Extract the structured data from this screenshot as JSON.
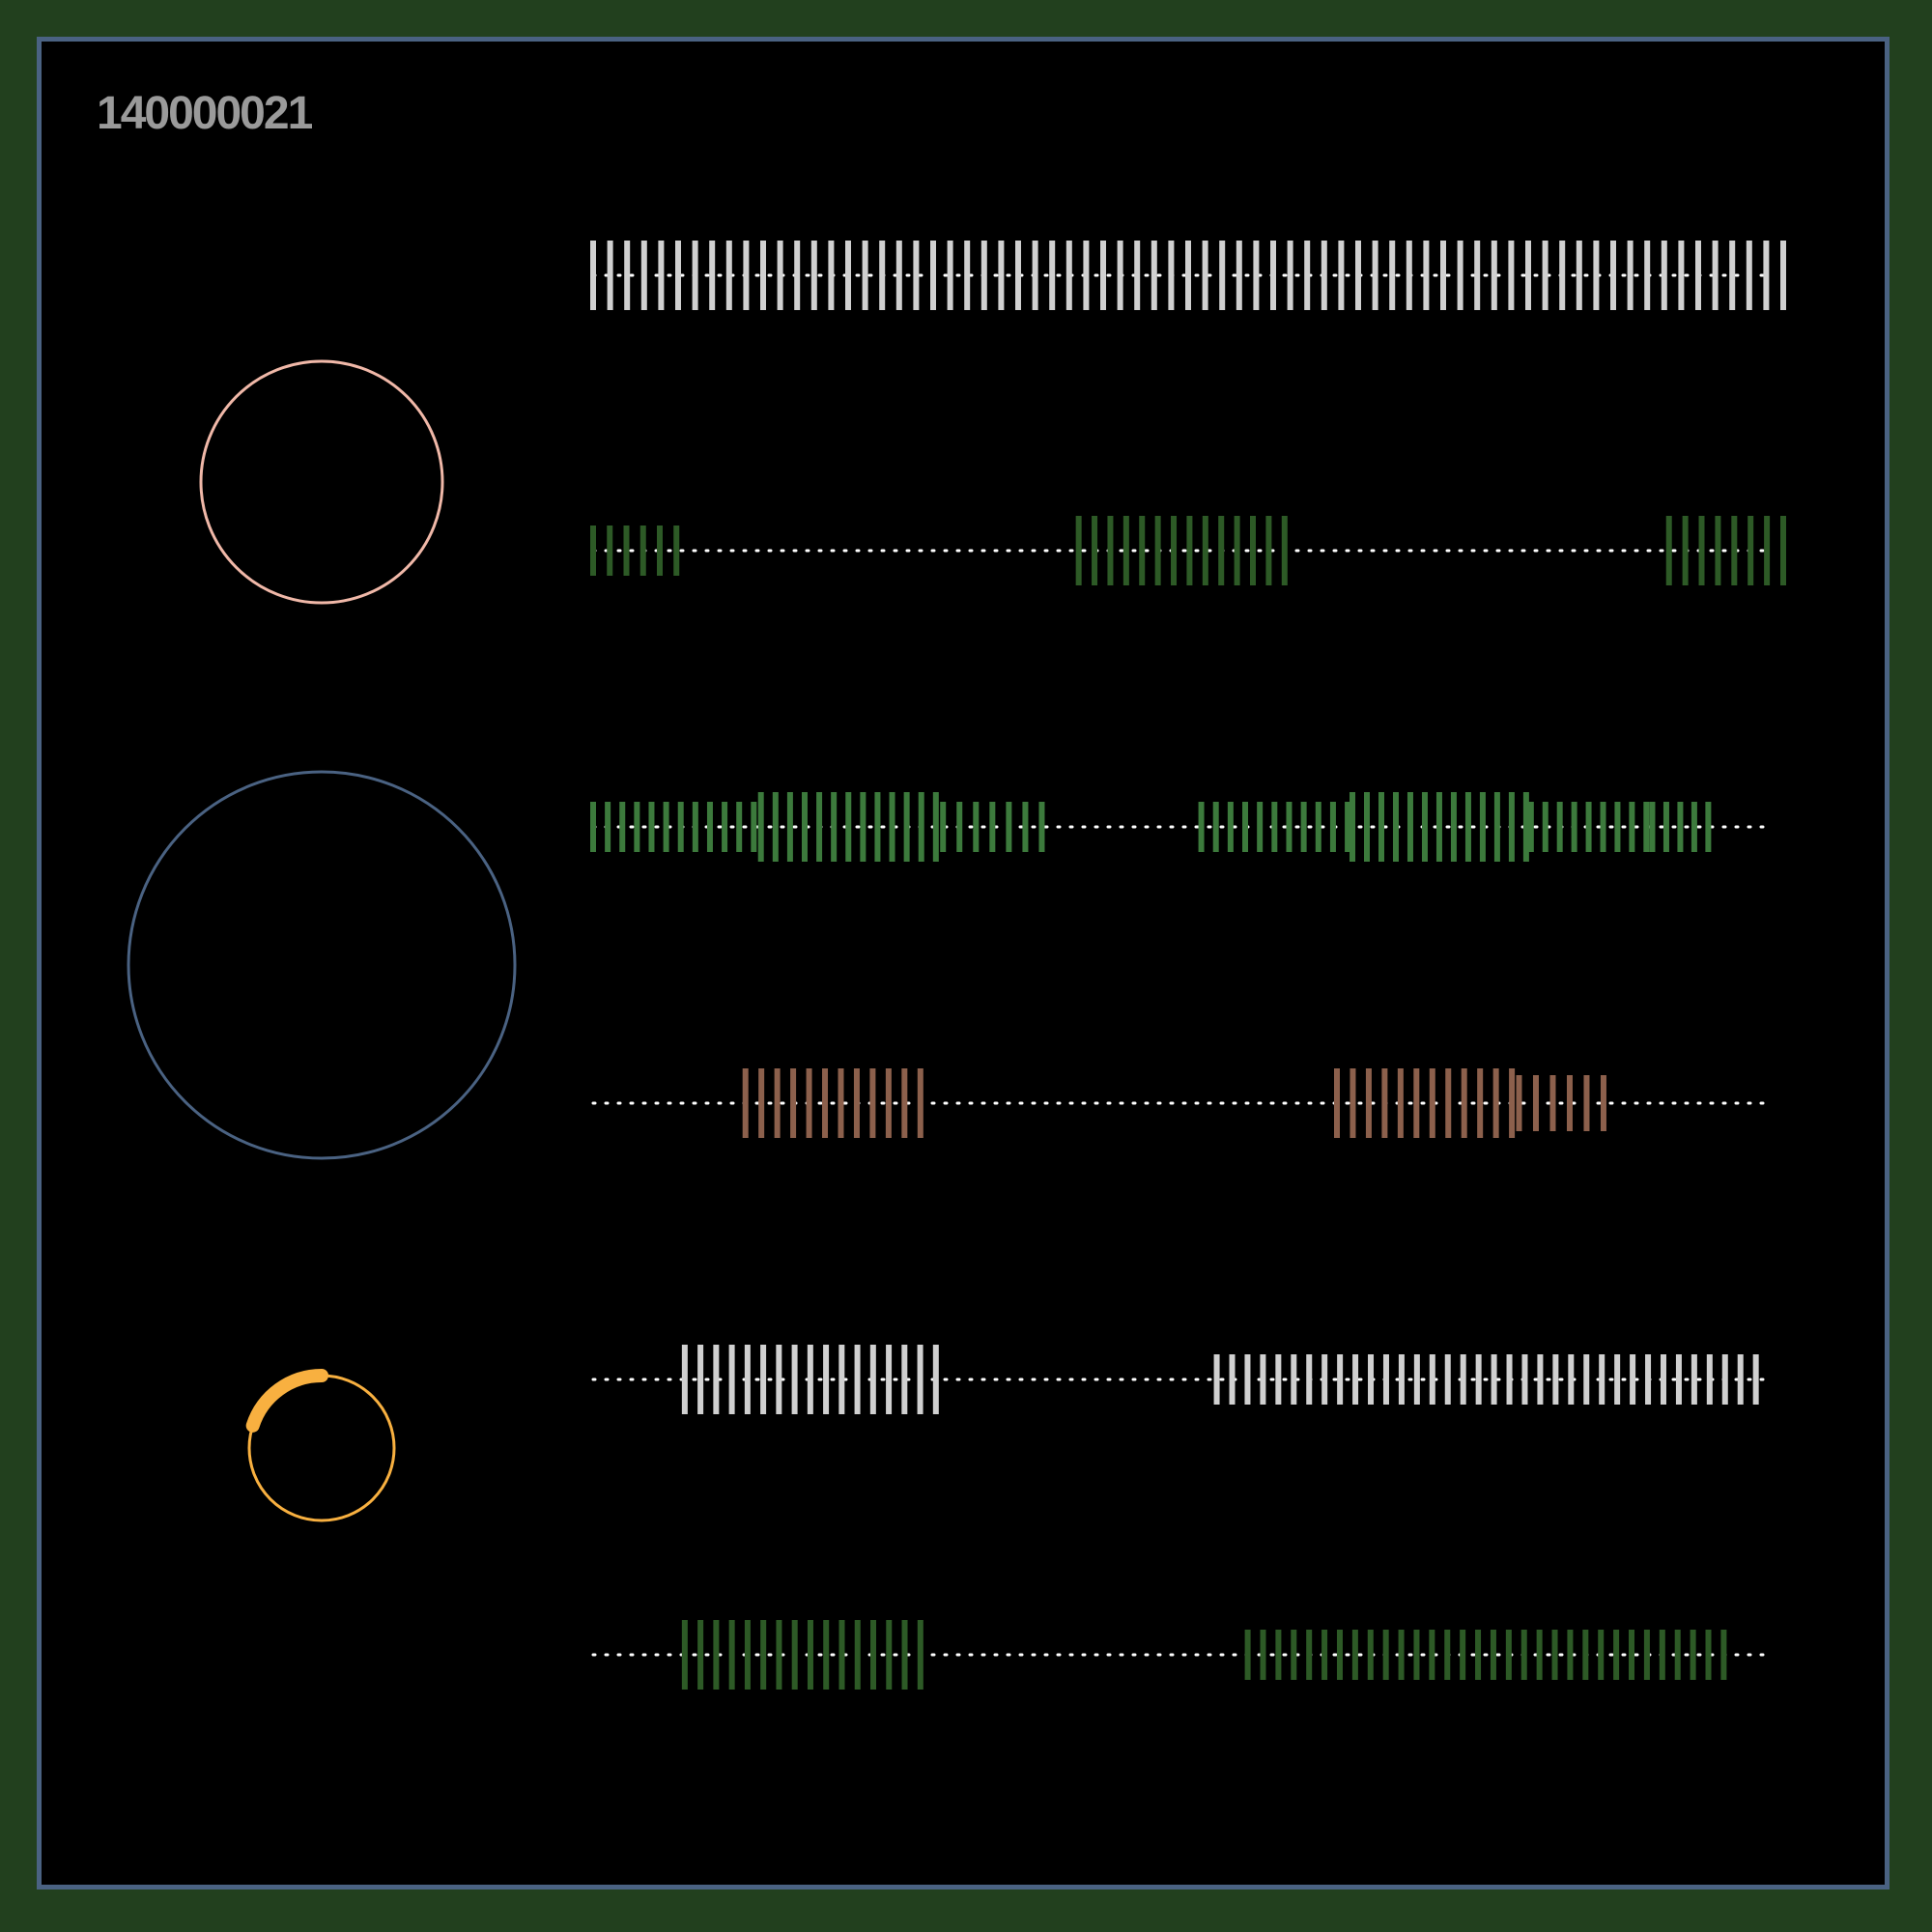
{
  "header": {
    "id_label": "140000021",
    "id_label_color": "#9a9a9a"
  },
  "colors": {
    "page_background": "#22401e",
    "frame_border": "#4a6282",
    "panel_background": "#000000",
    "dotted_track": "#ffffff"
  },
  "circles": [
    {
      "name": "pink-circle",
      "color": "#f0b8a8"
    },
    {
      "name": "blue-circle",
      "color": "#4a6282"
    },
    {
      "name": "orange-progress-ring",
      "color": "#f8b040",
      "progress_fraction": 0.2
    }
  ],
  "tracks": [
    {
      "name": "track-1",
      "color": "#d0d0d0",
      "segments": [
        {
          "start": 0.0,
          "end": 1.0,
          "bars": 71,
          "level": "high"
        }
      ]
    },
    {
      "name": "track-2",
      "color": "#2d5a26",
      "segments": [
        {
          "start": 0.0,
          "end": 0.07,
          "bars": 6,
          "level": "medium"
        },
        {
          "start": 0.408,
          "end": 0.581,
          "bars": 14,
          "level": "high"
        },
        {
          "start": 0.904,
          "end": 1.0,
          "bars": 8,
          "level": "high"
        }
      ]
    },
    {
      "name": "track-3",
      "color": "#3c7a3c",
      "segments": [
        {
          "start": 0.0,
          "end": 0.135,
          "bars": 12,
          "level": "medium"
        },
        {
          "start": 0.141,
          "end": 0.288,
          "bars": 13,
          "level": "high"
        },
        {
          "start": 0.294,
          "end": 0.377,
          "bars": 7,
          "level": "medium"
        },
        {
          "start": 0.511,
          "end": 0.634,
          "bars": 11,
          "level": "medium"
        },
        {
          "start": 0.638,
          "end": 0.784,
          "bars": 13,
          "level": "high"
        },
        {
          "start": 0.788,
          "end": 0.885,
          "bars": 9,
          "level": "medium"
        },
        {
          "start": 0.89,
          "end": 0.937,
          "bars": 5,
          "level": "medium"
        }
      ]
    },
    {
      "name": "track-4",
      "color": "#8c604c",
      "segments": [
        {
          "start": 0.128,
          "end": 0.275,
          "bars": 12,
          "level": "high"
        },
        {
          "start": 0.625,
          "end": 0.772,
          "bars": 12,
          "level": "high"
        },
        {
          "start": 0.778,
          "end": 0.849,
          "bars": 6,
          "level": "low"
        }
      ]
    },
    {
      "name": "track-5",
      "color": "#d0d0d0",
      "segments": [
        {
          "start": 0.077,
          "end": 0.288,
          "bars": 17,
          "level": "high"
        },
        {
          "start": 0.524,
          "end": 0.977,
          "bars": 36,
          "level": "medium"
        }
      ]
    },
    {
      "name": "track-6",
      "color": "#2d5a26",
      "segments": [
        {
          "start": 0.077,
          "end": 0.275,
          "bars": 16,
          "level": "high"
        },
        {
          "start": 0.55,
          "end": 0.95,
          "bars": 32,
          "level": "medium"
        }
      ]
    }
  ]
}
